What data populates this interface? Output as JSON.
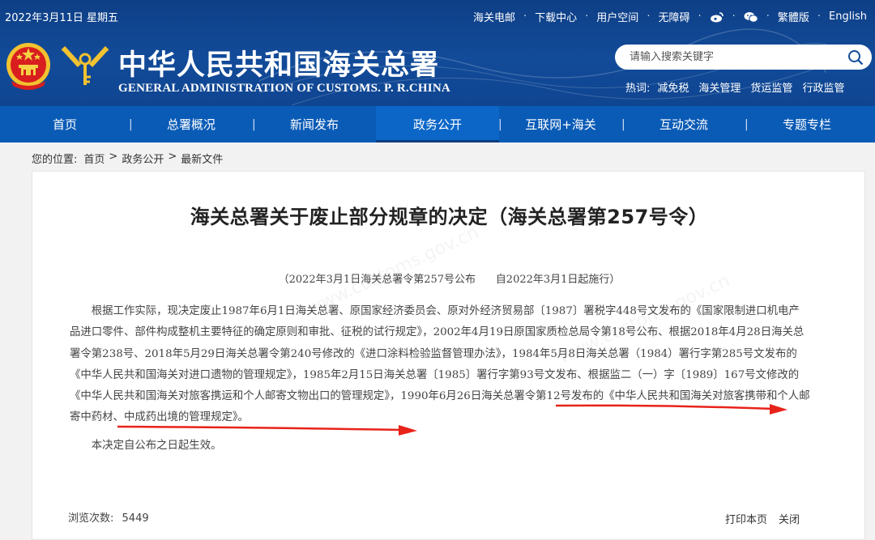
{
  "header": {
    "date": "2022年3月11日 星期五",
    "top_links": [
      "海关电邮",
      "下载中心",
      "用户空间",
      "无障碍"
    ],
    "lang_links": [
      "繁體版",
      "English"
    ],
    "site_title": "中华人民共和国海关总署",
    "site_subtitle": "GENERAL ADMINISTRATION OF CUSTOMS. P. R.CHINA",
    "search_placeholder": "请输入搜索关键字",
    "hot_label": "热词:",
    "hot_keywords": [
      "减免税",
      "海关管理",
      "货运监管",
      "行政监管"
    ]
  },
  "nav": {
    "items": [
      "首页",
      "总署概况",
      "新闻发布",
      "政务公开",
      "互联网+海关",
      "互动交流",
      "专题专栏"
    ],
    "active": "政务公开"
  },
  "breadcrumb": {
    "prefix": "您的位置:",
    "items": [
      "首页",
      "政务公开",
      "最新文件"
    ]
  },
  "article": {
    "title": "海关总署关于废止部分规章的决定（海关总署第257号令）",
    "meta": "（2022年3月1日海关总署令第257号公布      自2022年3月1日起施行）",
    "paragraph1": "根据工作实际，现决定废止1987年6月1日海关总署、原国家经济委员会、原对外经济贸易部〔1987〕署税字448号文发布的《国家限制进口机电产品进口零件、部件构成整机主要特征的确定原则和审批、征税的试行规定》，2002年4月19日原国家质检总局令第18号公布、根据2018年4月28日海关总署令第238号、2018年5月29日海关总署令第240号修改的《进口涂料检验监督管理办法》，1984年5月8日海关总署（1984）署行字第285号文发布的《中华人民共和国海关对进口遗物的管理规定》，1985年2月15日海关总署〔1985〕署行字第93号文发布、根据监二（一）字〔1989〕167号文修改的《中华人民共和国海关对旅客携运和个人邮寄文物出口的管理规定》，1990年6月26日海关总署令第12号发布的《中华人民共和国海关对旅客携带和个人邮寄中药材、中成药出境的管理规定》。",
    "paragraph2": "本决定自公布之日起生效。",
    "views_label": "浏览次数:",
    "views_count": "5449",
    "print_label": "打印本页",
    "close_label": "关闭"
  },
  "colors": {
    "header_blue": "#124b99",
    "nav_blue": "#0a5bb6",
    "annotation_red": "#e8231a"
  }
}
